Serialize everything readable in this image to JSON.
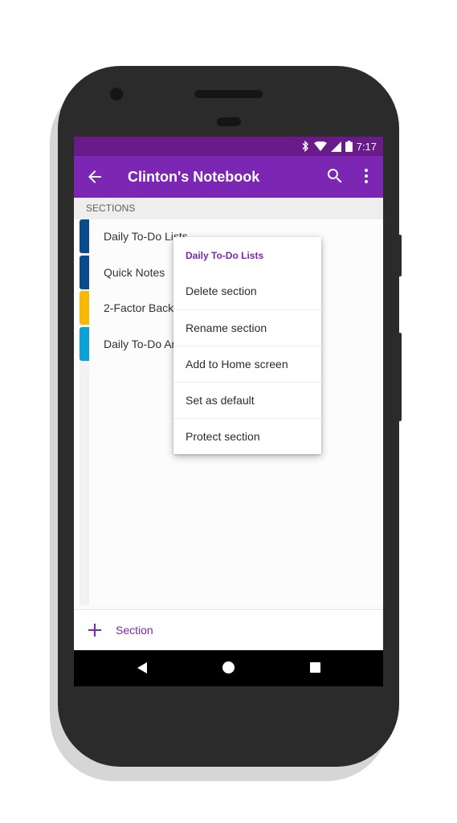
{
  "status_bar": {
    "time": "7:17",
    "icons": [
      "bluetooth-icon",
      "wifi-icon",
      "signal-icon",
      "battery-icon"
    ]
  },
  "app_bar": {
    "title": "Clinton's Notebook",
    "icons": [
      "back-arrow-icon",
      "search-icon",
      "more-vert-icon"
    ],
    "color": "#7b27b4"
  },
  "sections": {
    "header": "SECTIONS",
    "items": [
      {
        "label": "Daily To-Do Lists",
        "color": "#0a4c8a"
      },
      {
        "label": "Quick Notes",
        "color": "#0a4c8a"
      },
      {
        "label": "2-Factor Backup",
        "color": "#f6b900"
      },
      {
        "label": "Daily To-Do Archive",
        "color": "#0aa1d6"
      }
    ]
  },
  "context_menu": {
    "title": "Daily To-Do Lists",
    "items": [
      {
        "label": "Delete section"
      },
      {
        "label": "Rename section"
      },
      {
        "label": "Add to Home screen"
      },
      {
        "label": "Set as default"
      },
      {
        "label": "Protect section"
      }
    ]
  },
  "bottom_bar": {
    "add_label": "Section",
    "icon": "plus-icon"
  },
  "nav_bar": {
    "icons": [
      "nav-back-icon",
      "nav-home-icon",
      "nav-recents-icon"
    ]
  }
}
